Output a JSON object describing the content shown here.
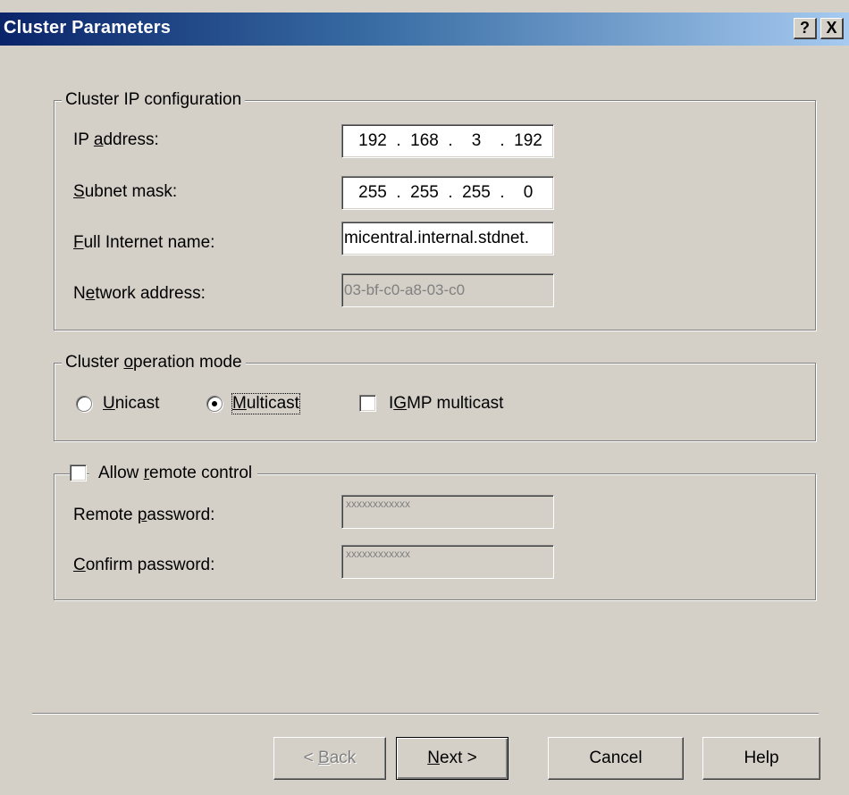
{
  "window": {
    "title": "Cluster Parameters",
    "help_button": "?",
    "close_button": "X"
  },
  "ip_config": {
    "legend": "Cluster IP configuration",
    "ip_label_pre": "IP ",
    "ip_label_ul": "a",
    "ip_label_post": "ddress:",
    "ip_segments": [
      "192",
      "168",
      "3",
      "192"
    ],
    "subnet_label_ul": "S",
    "subnet_label_post": "ubnet mask:",
    "subnet_segments": [
      "255",
      "255",
      "255",
      "0"
    ],
    "fullname_label_ul": "F",
    "fullname_label_post": "ull Internet name:",
    "fullname_value": "micentral.internal.stdnet.",
    "netaddr_label_pre": "N",
    "netaddr_label_ul": "e",
    "netaddr_label_post": "twork address:",
    "netaddr_value": "03-bf-c0-a8-03-c0"
  },
  "operation_mode": {
    "legend_pre": "Cluster ",
    "legend_ul": "o",
    "legend_post": "peration mode",
    "unicast_ul": "U",
    "unicast_post": "nicast",
    "unicast_selected": false,
    "multicast_ul": "M",
    "multicast_post": "ulticast",
    "multicast_selected": true,
    "igmp_pre": "I",
    "igmp_ul": "G",
    "igmp_post": "MP multicast",
    "igmp_checked": false
  },
  "remote_control": {
    "legend_pre": "Allow ",
    "legend_ul": "r",
    "legend_post": "emote control",
    "checked": false,
    "remote_pw_label_pre": "Remote ",
    "remote_pw_label_ul": "p",
    "remote_pw_label_post": "assword:",
    "remote_pw_value": "xxxxxxxxxxxx",
    "confirm_pw_label_ul": "C",
    "confirm_pw_label_post": "onfirm password:",
    "confirm_pw_value": "xxxxxxxxxxxx"
  },
  "buttons": {
    "back_pre": "< ",
    "back_ul": "B",
    "back_post": "ack",
    "next_ul": "N",
    "next_post": "ext >",
    "cancel": "Cancel",
    "help": "Help"
  }
}
